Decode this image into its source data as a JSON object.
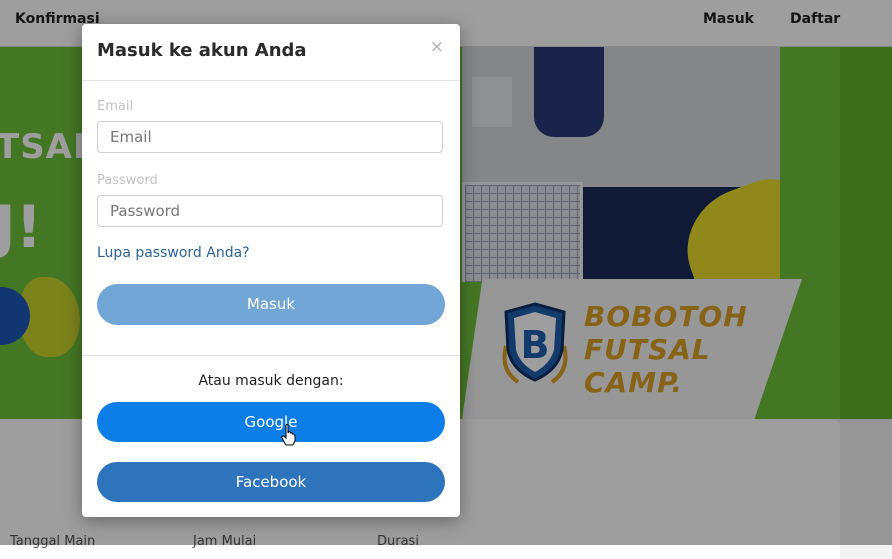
{
  "nav": {
    "brand": "Konfirmasi",
    "login": "Masuk",
    "register": "Daftar"
  },
  "hero": {
    "text_line1": "TSAL",
    "text_line2": "J!",
    "banner_text": [
      "BOBOTOH",
      "FUTSAL",
      "CAMP."
    ]
  },
  "card": {
    "columns": [
      "Tanggal Main",
      "Jam Mulai",
      "Durasi"
    ]
  },
  "modal": {
    "title": "Masuk ke akun Anda",
    "close": "×",
    "email_label": "Email",
    "email_placeholder": "Email",
    "password_label": "Password",
    "password_placeholder": "Password",
    "forgot": "Lupa password Anda?",
    "submit": "Masuk",
    "alt_text": "Atau masuk dengan:",
    "google": "Google",
    "facebook": "Facebook"
  },
  "colors": {
    "primary_muted": "#72a6d6",
    "google_button": "#0d7ee8",
    "facebook_button": "#2d74bd",
    "link": "#2a6496",
    "hero_green": "#6fc03a",
    "banner_gold": "#d9a126"
  }
}
